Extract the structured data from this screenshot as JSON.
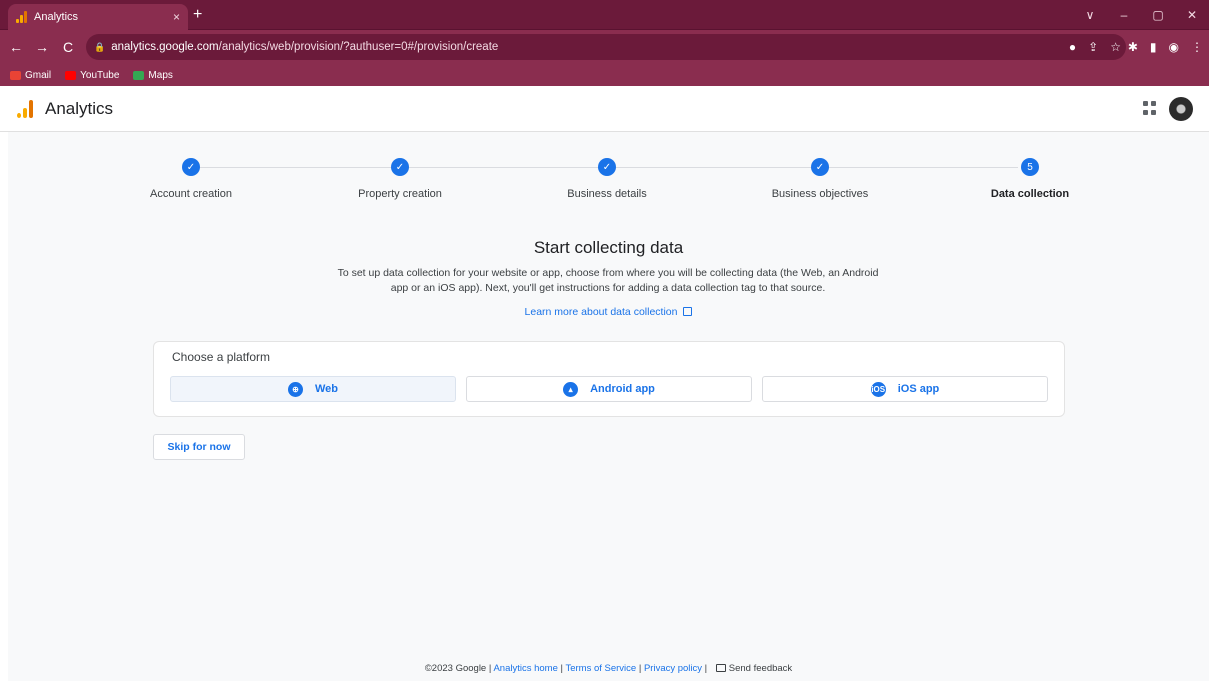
{
  "browser": {
    "tab_title": "Analytics",
    "tab_close": "×",
    "new_tab": "+",
    "url_host": "analytics.google.com",
    "url_path": "/analytics/web/provision/?authuser=0#/provision/create",
    "back": "←",
    "forward": "→",
    "reload": "C",
    "window_controls": [
      "∨",
      "–",
      "▢",
      "✕"
    ],
    "bookmarks": [
      {
        "label": "Gmail",
        "color": "#ea4335"
      },
      {
        "label": "YouTube",
        "color": "#ff0000"
      },
      {
        "label": "Maps",
        "color": "#34a853"
      }
    ]
  },
  "app": {
    "title": "Analytics"
  },
  "stepper": {
    "steps": [
      {
        "label": "Account creation",
        "state": "done",
        "mark": "✓"
      },
      {
        "label": "Property creation",
        "state": "done",
        "mark": "✓"
      },
      {
        "label": "Business details",
        "state": "done",
        "mark": "✓"
      },
      {
        "label": "Business objectives",
        "state": "done",
        "mark": "✓"
      },
      {
        "label": "Data collection",
        "state": "active",
        "mark": "5"
      }
    ]
  },
  "main": {
    "heading": "Start collecting data",
    "description": "To set up data collection for your website or app, choose from where you will be collecting data (the Web, an Android app or an iOS app). Next, you'll get instructions for adding a data collection tag to that source.",
    "learn_more": "Learn more about data collection"
  },
  "platform": {
    "title": "Choose a platform",
    "options": [
      {
        "label": "Web",
        "icon": "globe-icon",
        "selected": true
      },
      {
        "label": "Android app",
        "icon": "android-icon",
        "selected": false
      },
      {
        "label": "iOS app",
        "icon": "ios-icon",
        "icon_text": "iOS",
        "selected": false
      }
    ]
  },
  "skip_label": "Skip for now",
  "footer": {
    "copyright": "©2023 Google |",
    "analytics_home": "Analytics home",
    "sep1": "|",
    "terms": "Terms of Service",
    "sep2": "|",
    "privacy": "Privacy policy",
    "sep3": "|",
    "feedback": "Send feedback"
  },
  "colors": {
    "accent": "#1a73e8",
    "browser_frame": "#8a2d4f"
  }
}
